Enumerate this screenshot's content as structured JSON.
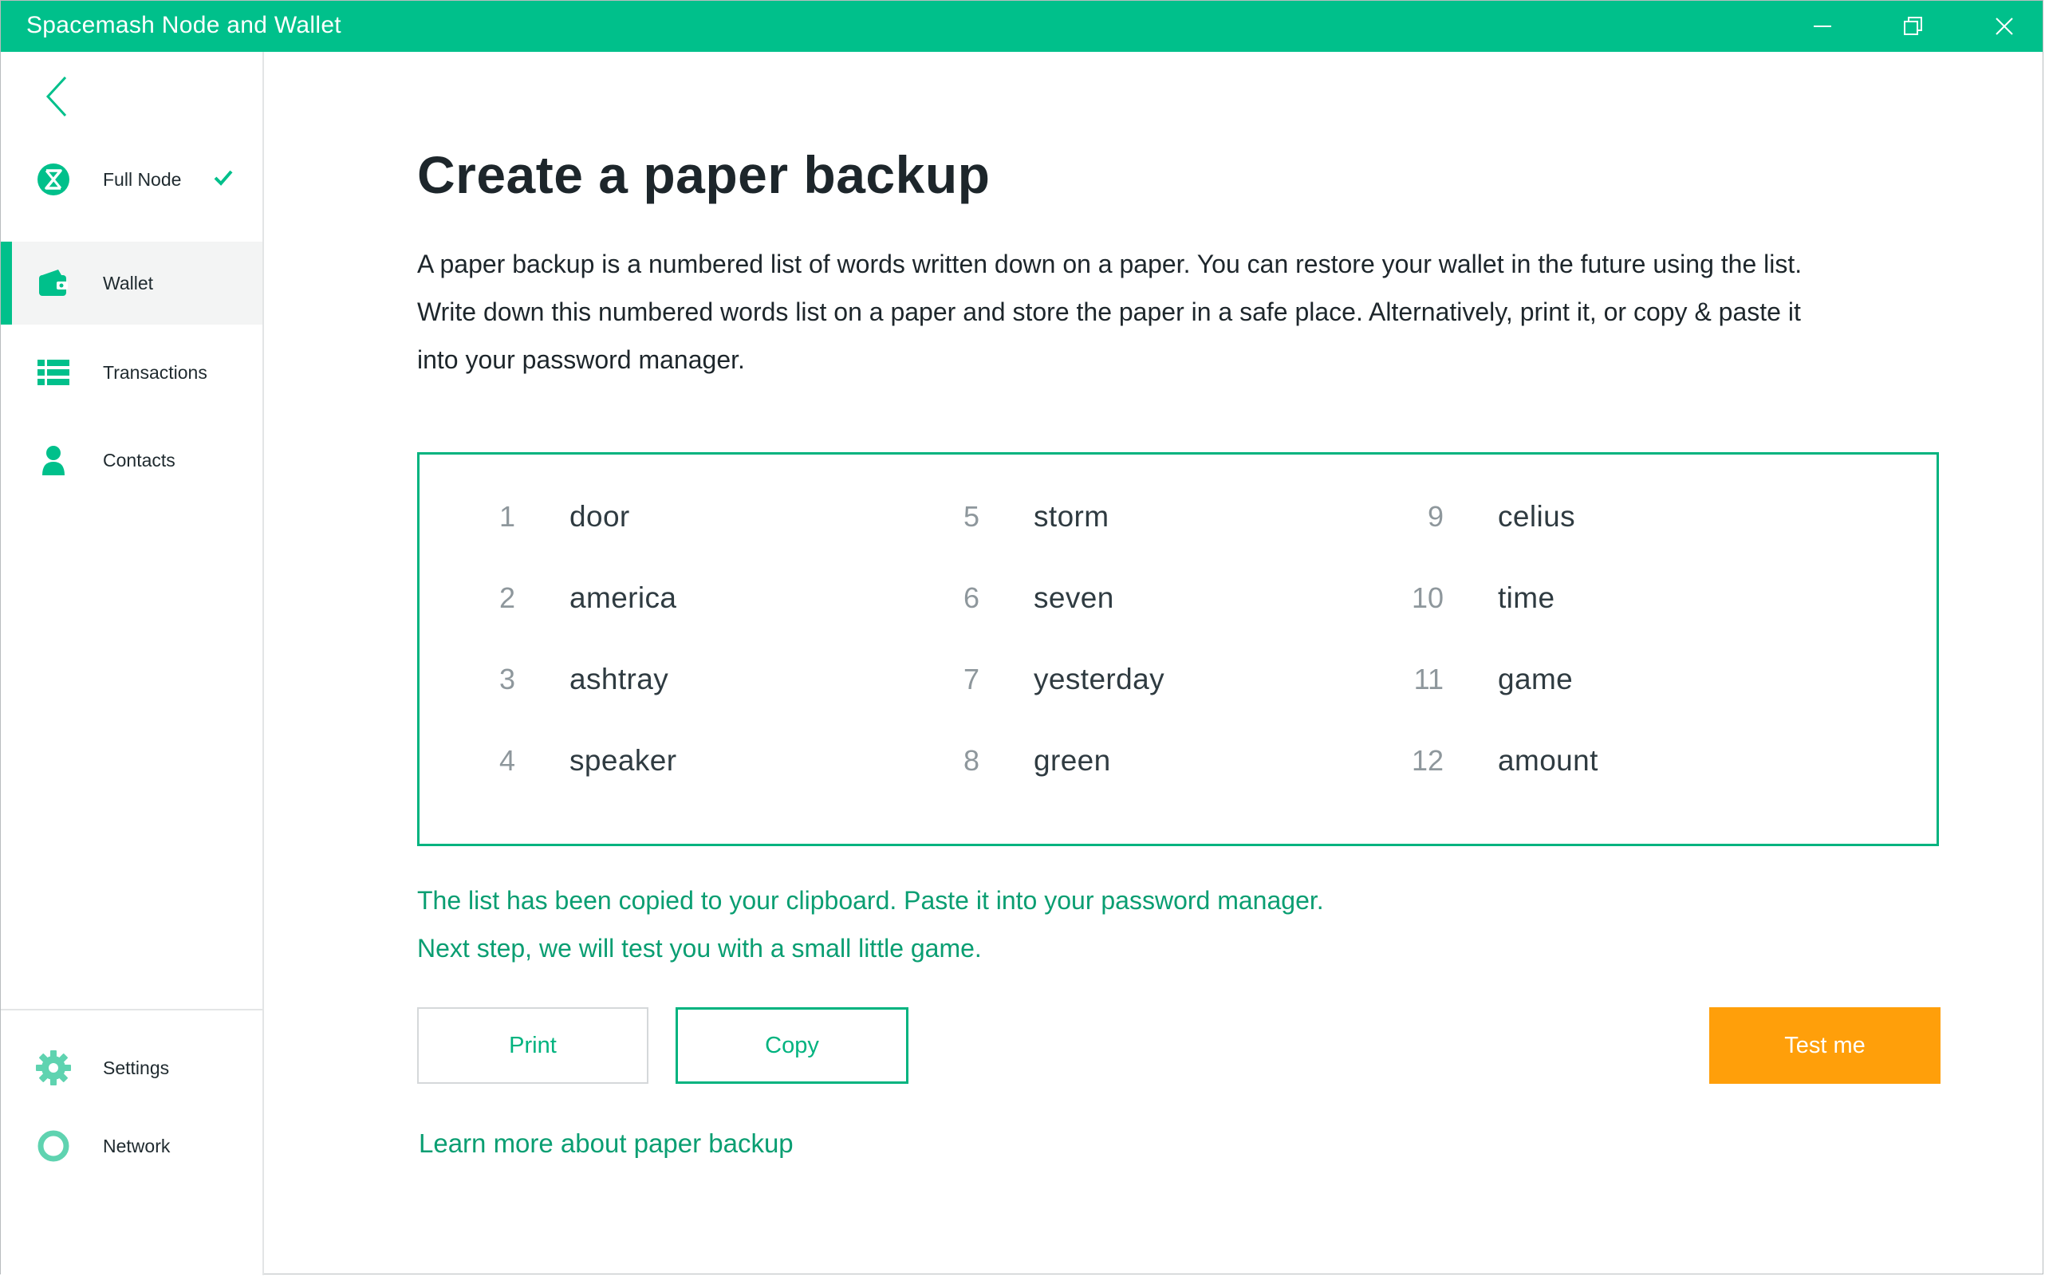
{
  "window": {
    "title": "Spacemash Node and Wallet",
    "controls": [
      "minimize-icon",
      "restore-icon",
      "close-icon"
    ]
  },
  "colors": {
    "brand": "#00c08b",
    "accent_text": "#0a9e72",
    "border": "#00b37f",
    "cta": "#ff9f0a"
  },
  "sidebar": {
    "back_icon": "chevron-left-icon",
    "items": [
      {
        "label": "Full Node",
        "icon": "spacemesh-logo-icon",
        "status": "check-icon"
      },
      {
        "label": "Wallet",
        "icon": "wallet-icon",
        "active": true
      },
      {
        "label": "Transactions",
        "icon": "list-icon"
      },
      {
        "label": "Contacts",
        "icon": "person-icon"
      }
    ],
    "bottom_items": [
      {
        "label": "Settings",
        "icon": "gear-icon"
      },
      {
        "label": "Network",
        "icon": "ring-icon"
      }
    ]
  },
  "main": {
    "title": "Create a paper backup",
    "description": [
      "A paper backup is a numbered list of words written down on a paper. You can restore your wallet in the future using the list.",
      "Write down this numbered words list on a paper and store the paper in a safe place.  Alternatively, print it, or copy & paste it",
      "into your password manager."
    ],
    "words": [
      {
        "n": "1",
        "w": "door"
      },
      {
        "n": "2",
        "w": "america"
      },
      {
        "n": "3",
        "w": "ashtray"
      },
      {
        "n": "4",
        "w": "speaker"
      },
      {
        "n": "5",
        "w": "storm"
      },
      {
        "n": "6",
        "w": "seven"
      },
      {
        "n": "7",
        "w": "yesterday"
      },
      {
        "n": "8",
        "w": "green"
      },
      {
        "n": "9",
        "w": "celius"
      },
      {
        "n": "10",
        "w": "time"
      },
      {
        "n": "11",
        "w": "game"
      },
      {
        "n": "12",
        "w": "amount"
      }
    ],
    "notes": [
      "The list has been copied to your clipboard. Paste it into your password manager.",
      "Next step, we will test you with a small little game."
    ],
    "buttons": {
      "print": "Print",
      "copy": "Copy",
      "test": "Test me"
    },
    "learn_more": "Learn more about paper backup"
  }
}
